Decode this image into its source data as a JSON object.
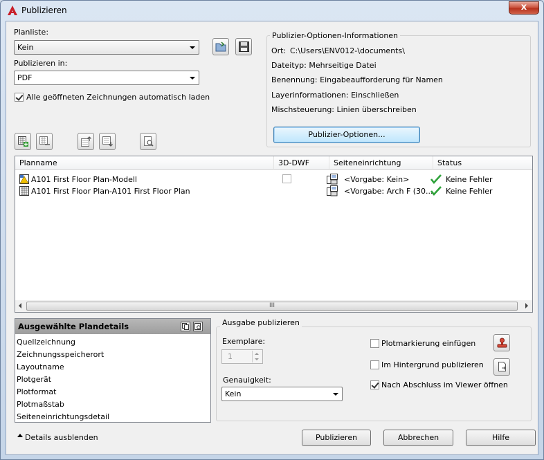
{
  "window": {
    "title": "Publizieren",
    "close_glyph": "x"
  },
  "sheet_list": {
    "label": "Planliste:",
    "value": "Kein"
  },
  "publish_to": {
    "label": "Publizieren in:",
    "value": "PDF"
  },
  "auto_load": {
    "label": "Alle geöffneten Zeichnungen automatisch laden",
    "checked": true
  },
  "options_info": {
    "title": "Publizier-Optionen-Informationen",
    "location_label": "Ort:",
    "location_value": "C:\\Users\\ENV012-\\documents\\",
    "filetype": "Dateityp: Mehrseitige Datei",
    "naming": "Benennung: Eingabeaufforderung für Namen",
    "layer_info": "Layerinformationen: Einschließen",
    "merge_control": "Mischsteuerung: Linien überschreiben",
    "button": "Publizier-Optionen..."
  },
  "sheets": {
    "columns": [
      "Planname",
      "3D-DWF",
      "Seiteneinrichtung",
      "Status"
    ],
    "rows": [
      {
        "name": "A101 First Floor Plan-Modell",
        "page_setup": "<Vorgabe: Kein>",
        "status": "Keine Fehler"
      },
      {
        "name": "A101 First Floor Plan-A101 First Floor Plan",
        "page_setup": "<Vorgabe: Arch F (30...",
        "status": "Keine Fehler"
      }
    ],
    "scroll_grip": "III"
  },
  "details": {
    "title": "Ausgewählte Plandetails",
    "items": [
      "Quellzeichnung",
      "Zeichnungsspeicherort",
      "Layoutname",
      "Plotgerät",
      "Plotformat",
      "Plotmaßstab",
      "Seiteneinrichtungsdetail"
    ]
  },
  "output": {
    "title": "Ausgabe publizieren",
    "copies_label": "Exemplare:",
    "copies_value": "1",
    "precision_label": "Genauigkeit:",
    "precision_value": "Kein",
    "plot_stamp": {
      "label": "Plotmarkierung einfügen",
      "checked": false
    },
    "background": {
      "label": "Im Hintergrund publizieren",
      "checked": false
    },
    "open_viewer": {
      "label": "Nach Abschluss im Viewer öffnen",
      "checked": true
    }
  },
  "footer": {
    "hide_details": "Details ausblenden",
    "publish": "Publizieren",
    "cancel": "Abbrechen",
    "help": "Hilfe"
  },
  "colors": {
    "accent": "#3c7fb1",
    "ok_check": "#2fa23a",
    "autocad_red": "#c8202a"
  }
}
